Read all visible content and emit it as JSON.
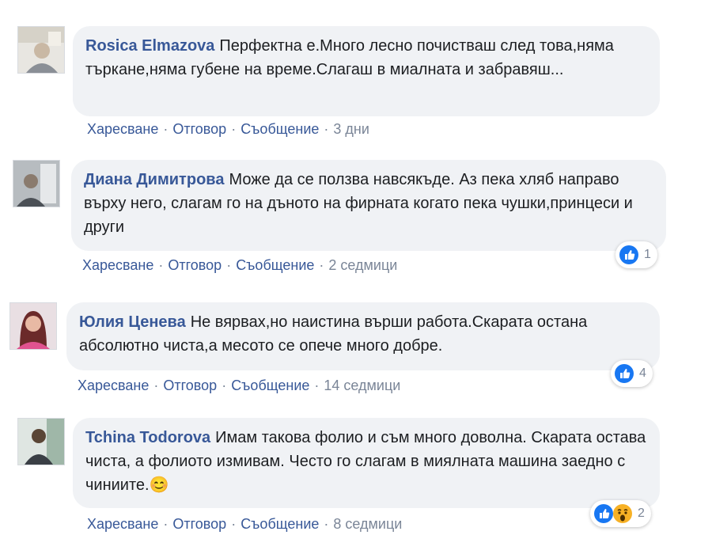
{
  "actions": {
    "like": "Харесване",
    "reply": "Отговор",
    "message": "Съобщение"
  },
  "comments": [
    {
      "author": "Rosica Elmazova",
      "text": "Перфектна е.Много лесно почистваш след това,няма търкане,няма губене на време.Слагаш в миалната и забравяш...",
      "time": "3 дни",
      "reactions": null
    },
    {
      "author": "Диана Димитрова",
      "text": "Може да се ползва навсякъде. Аз пека хляб направо върху него, слагам го на дъното на фирната когато пека чушки,принцеси и други",
      "time": "2 седмици",
      "reactions": {
        "types": [
          "like"
        ],
        "count": "1"
      }
    },
    {
      "author": "Юлия Ценева",
      "text": "Не вярвах,но наистина върши работа.Скарата остана абсолютно чиста,а месото се опече много добре.",
      "time": "14 седмици",
      "reactions": {
        "types": [
          "like"
        ],
        "count": "4"
      }
    },
    {
      "author": "Tchina Todorova",
      "text": "Имам такова фолио и съм много доволна. Скарата остава чиста, а фолиото измивам. Често го слагам в миялната машина заедно с чиниите.",
      "emoji": "😊",
      "time": "8 седмици",
      "reactions": {
        "types": [
          "like",
          "wow"
        ],
        "count": "2"
      }
    }
  ],
  "colors": {
    "author": "#385898",
    "bubble": "#f0f2f5",
    "like": "#1877f2",
    "wow": "#f7b125"
  }
}
